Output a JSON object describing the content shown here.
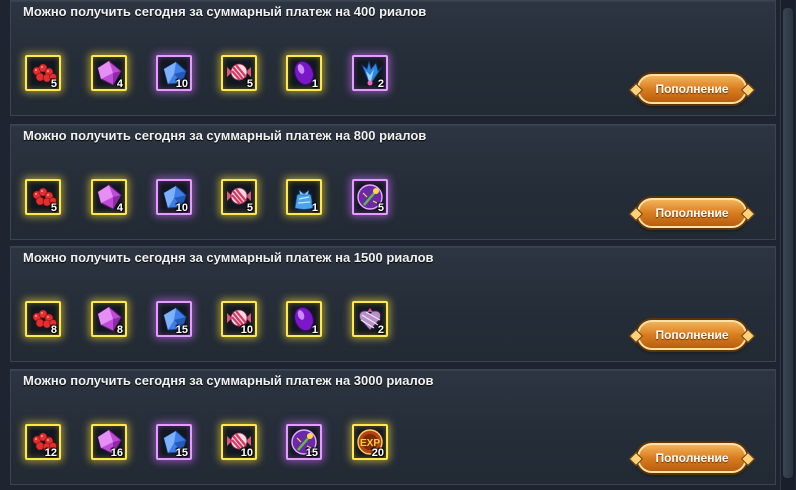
{
  "panels": [
    {
      "title": "Можно получить сегодня за суммарный платеж на 400 риалов",
      "button_label": "Пополнение",
      "items": [
        {
          "icon": "red-berries-icon",
          "quantity": "5",
          "frame": "gold"
        },
        {
          "icon": "pink-crystal-icon",
          "quantity": "4",
          "frame": "gold"
        },
        {
          "icon": "blue-crystal-icon",
          "quantity": "10",
          "frame": "purple"
        },
        {
          "icon": "striped-candy-icon",
          "quantity": "5",
          "frame": "gold"
        },
        {
          "icon": "purple-gem-icon",
          "quantity": "1",
          "frame": "gold"
        },
        {
          "icon": "blue-wings-icon",
          "quantity": "2",
          "frame": "purple"
        }
      ]
    },
    {
      "title": "Можно получить сегодня за суммарный платеж на 800 риалов",
      "button_label": "Пополнение",
      "items": [
        {
          "icon": "red-berries-icon",
          "quantity": "5",
          "frame": "gold"
        },
        {
          "icon": "pink-crystal-icon",
          "quantity": "4",
          "frame": "gold"
        },
        {
          "icon": "blue-crystal-icon",
          "quantity": "10",
          "frame": "purple"
        },
        {
          "icon": "striped-candy-icon",
          "quantity": "5",
          "frame": "gold"
        },
        {
          "icon": "gift-pouch-icon",
          "quantity": "1",
          "frame": "gold"
        },
        {
          "icon": "purple-scepter-orb-icon",
          "quantity": "5",
          "frame": "purple"
        }
      ]
    },
    {
      "title": "Можно получить сегодня за суммарный платеж на 1500 риалов",
      "button_label": "Пополнение",
      "items": [
        {
          "icon": "red-berries-icon",
          "quantity": "8",
          "frame": "gold"
        },
        {
          "icon": "pink-crystal-icon",
          "quantity": "8",
          "frame": "gold"
        },
        {
          "icon": "blue-crystal-icon",
          "quantity": "15",
          "frame": "purple"
        },
        {
          "icon": "striped-candy-icon",
          "quantity": "10",
          "frame": "gold"
        },
        {
          "icon": "purple-gem-icon",
          "quantity": "1",
          "frame": "gold"
        },
        {
          "icon": "heart-gift-box-icon",
          "quantity": "2",
          "frame": "gold"
        }
      ]
    },
    {
      "title": "Можно получить сегодня за суммарный платеж на 3000 риалов",
      "button_label": "Пополнение",
      "items": [
        {
          "icon": "red-berries-icon",
          "quantity": "12",
          "frame": "gold"
        },
        {
          "icon": "pink-crystal-icon",
          "quantity": "16",
          "frame": "gold"
        },
        {
          "icon": "blue-crystal-icon",
          "quantity": "15",
          "frame": "purple"
        },
        {
          "icon": "striped-candy-icon",
          "quantity": "10",
          "frame": "gold"
        },
        {
          "icon": "purple-scepter-orb-icon",
          "quantity": "15",
          "frame": "purple"
        },
        {
          "icon": "exp-orb-icon",
          "quantity": "20",
          "frame": "gold"
        }
      ]
    }
  ]
}
